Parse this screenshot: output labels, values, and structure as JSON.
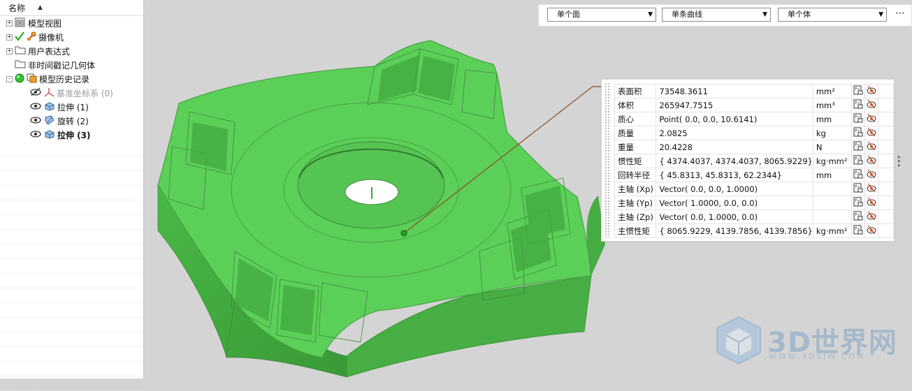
{
  "navigator": {
    "header": "名称",
    "items": [
      {
        "label": "模型视图",
        "expander": "+",
        "icon": "model-views-icon"
      },
      {
        "label": "摄像机",
        "expander": "+",
        "icon": "camera-icon"
      },
      {
        "label": "用户表达式",
        "expander": "+",
        "icon": "folder-icon"
      },
      {
        "label": "非时间戳记几何体",
        "expander": "",
        "icon": "folder-icon"
      },
      {
        "label": "模型历史记录",
        "expander": "-",
        "icon": "history-icon"
      },
      {
        "label": "基准坐标系 (0)",
        "icon": "datum-csys-icon"
      },
      {
        "label": "拉伸 (1)",
        "icon": "extrude-icon"
      },
      {
        "label": "旋转 (2)",
        "icon": "revolve-icon"
      },
      {
        "label": "拉伸 (3)",
        "icon": "extrude-icon"
      }
    ]
  },
  "filters": {
    "face": "单个面",
    "curve": "单条曲线",
    "body": "单个体",
    "more": "⋯"
  },
  "properties": [
    {
      "name": "表面积",
      "value": "73548.3611",
      "unit": "mm²"
    },
    {
      "name": "体积",
      "value": "265947.7515",
      "unit": "mm³"
    },
    {
      "name": "质心",
      "value": "Point( 0.0, 0.0, 10.6141)",
      "unit": "mm"
    },
    {
      "name": "质量",
      "value": "2.0825",
      "unit": "kg"
    },
    {
      "name": "重量",
      "value": "20.4228",
      "unit": "N"
    },
    {
      "name": "惯性矩",
      "value": "{ 4374.4037, 4374.4037, 8065.9229}",
      "unit": "kg·mm²"
    },
    {
      "name": "回转半径",
      "value": "{ 45.8313, 45.8313, 62.2344}",
      "unit": "mm"
    },
    {
      "name": "主轴 (Xp)",
      "value": "Vector( 0.0, 0.0, 1.0000)",
      "unit": ""
    },
    {
      "name": "主轴 (Yp)",
      "value": "Vector( 1.0000, 0.0, 0.0)",
      "unit": ""
    },
    {
      "name": "主轴 (Zp)",
      "value": "Vector( 0.0, 1.0000, 0.0)",
      "unit": ""
    },
    {
      "name": "主惯性矩",
      "value": "{ 8065.9229, 4139.7856, 4139.7856}",
      "unit": "kg·mm²"
    }
  ],
  "watermark": {
    "brand": "3D世界网",
    "url": "WWW.3DSJW.COM"
  },
  "colors": {
    "model": "#5ccf58",
    "leader": "#8b4a1f",
    "viewport": "#d4d4d4"
  }
}
